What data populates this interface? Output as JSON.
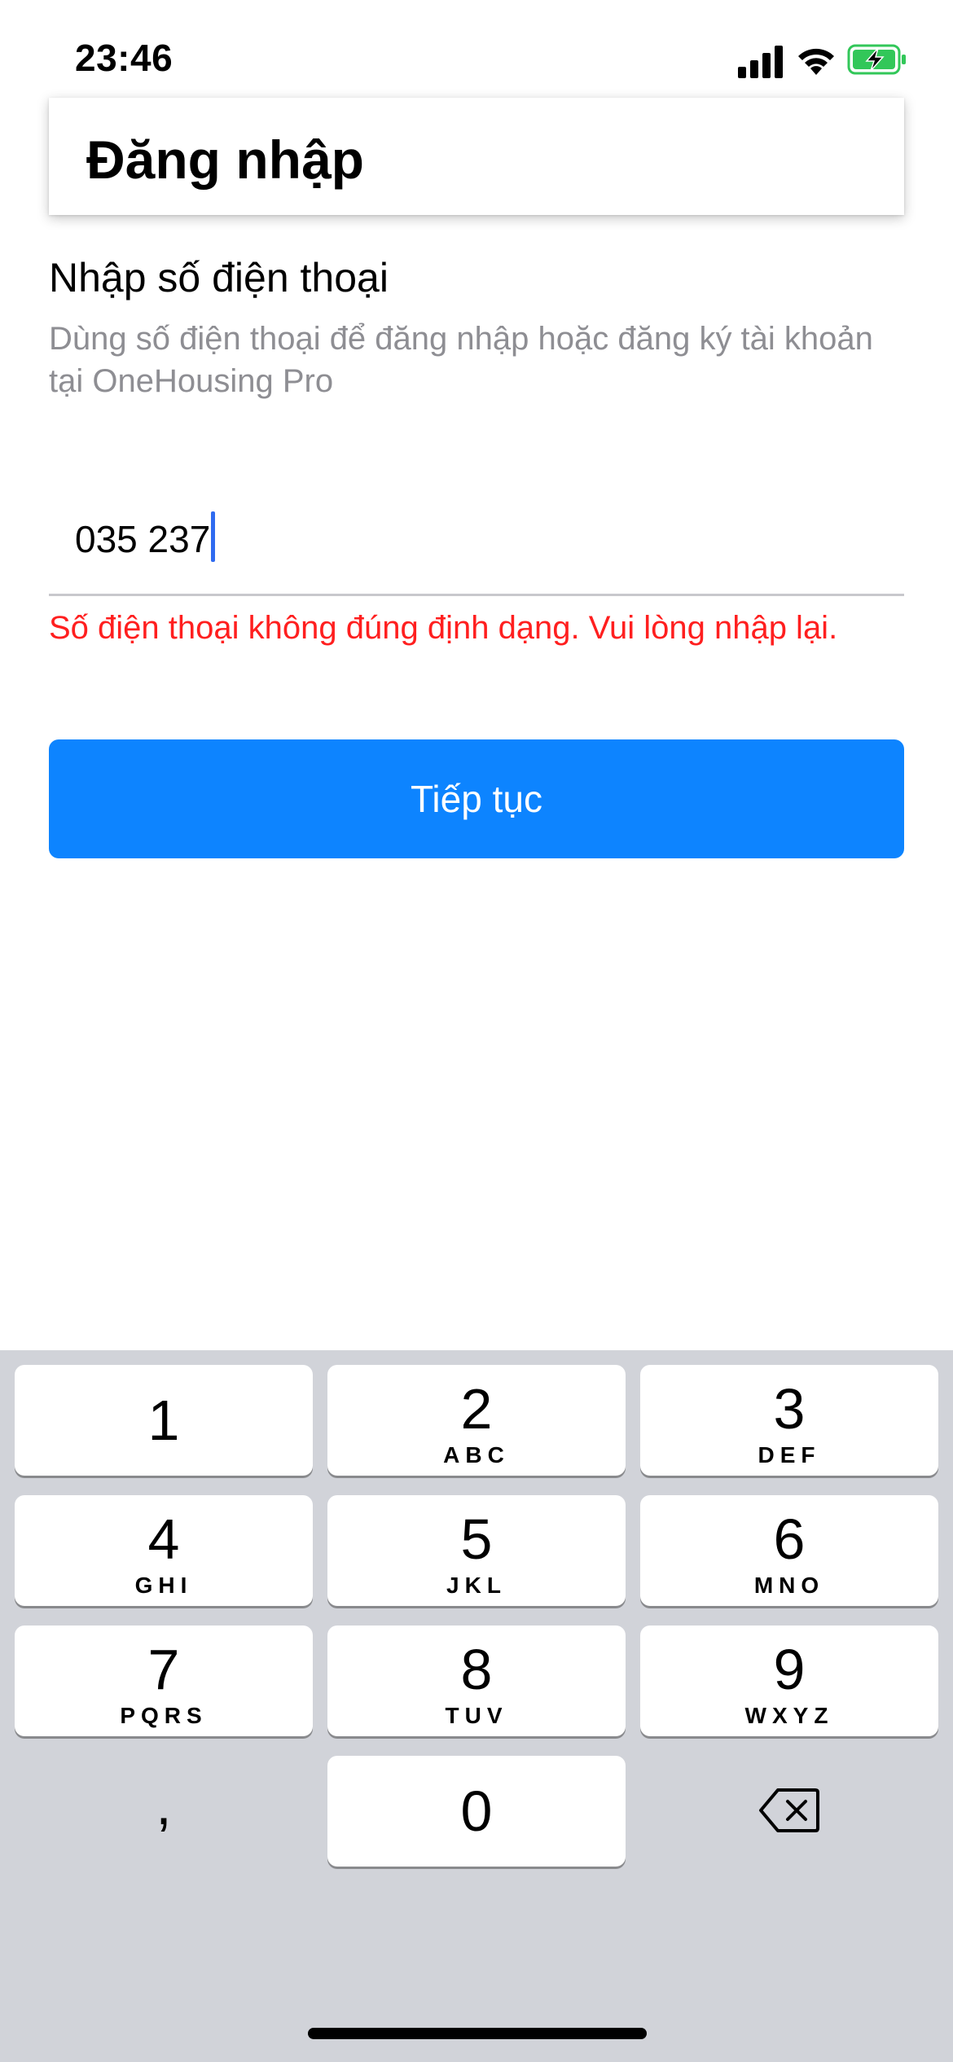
{
  "status_bar": {
    "time": "23:46",
    "battery_color": "#32c759"
  },
  "header": {
    "title": "Đăng nhập"
  },
  "form": {
    "section_title": "Nhập số điện thoại",
    "section_subtitle": "Dùng số điện thoại để đăng nhập hoặc đăng ký tài khoản tại OneHousing Pro",
    "phone_value": "035 237",
    "error_message": "Số điện thoại không đúng định dạng. Vui lòng nhập lại.",
    "continue_label": "Tiếp tục",
    "accent_color": "#0d84ff",
    "error_color": "#ff1f1f"
  },
  "keypad": {
    "keys": [
      {
        "digit": "1",
        "letters": ""
      },
      {
        "digit": "2",
        "letters": "ABC"
      },
      {
        "digit": "3",
        "letters": "DEF"
      },
      {
        "digit": "4",
        "letters": "GHI"
      },
      {
        "digit": "5",
        "letters": "JKL"
      },
      {
        "digit": "6",
        "letters": "MNO"
      },
      {
        "digit": "7",
        "letters": "PQRS"
      },
      {
        "digit": "8",
        "letters": "TUV"
      },
      {
        "digit": "9",
        "letters": "WXYZ"
      },
      {
        "digit": "0",
        "letters": ""
      }
    ],
    "comma_label": ",",
    "delete_icon": "delete-backspace-icon"
  }
}
